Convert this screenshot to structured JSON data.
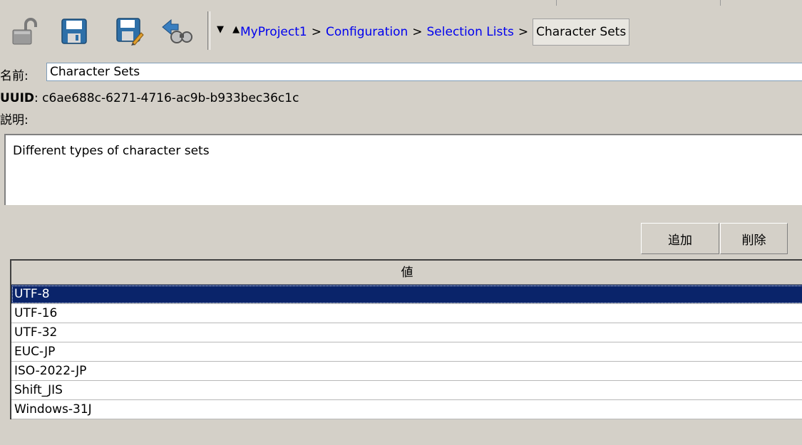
{
  "toolbar": {
    "icons": [
      "unlock-icon",
      "save-icon",
      "save-as-icon",
      "find-references-icon"
    ],
    "nav_arrows": "▼ ▲",
    "breadcrumb": {
      "items": [
        "MyProject1",
        "Configuration",
        "Selection Lists"
      ],
      "separator": ">",
      "current": "Character Sets"
    }
  },
  "form": {
    "name_label": "名前:",
    "name_value": "Character Sets",
    "uuid_label": "UUID",
    "uuid_value": ": c6ae688c-6271-4716-ac9b-b933bec36c1c",
    "description_label": "説明:",
    "description_value": "Different types of character sets"
  },
  "buttons": {
    "add": "追加",
    "delete": "削除"
  },
  "table": {
    "header": "値",
    "rows": [
      "UTF-8",
      "UTF-16",
      "UTF-32",
      "EUC-JP",
      "ISO-2022-JP",
      "Shift_JIS",
      "Windows-31J"
    ],
    "selected_index": 0
  },
  "colors": {
    "background": "#d4d0c8",
    "selection": "#0a246a",
    "link": "#0000ee"
  }
}
